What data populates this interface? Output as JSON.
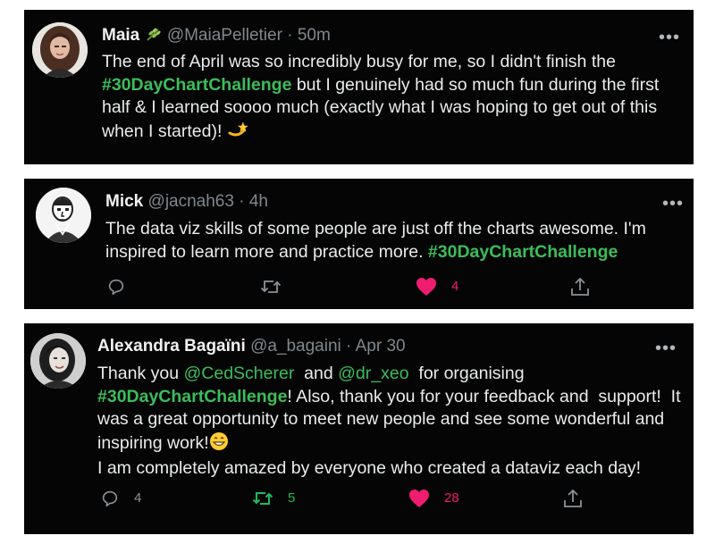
{
  "tweets": [
    {
      "name": "Maia",
      "name_emoji": "🌿",
      "handle": "@MaiaPelletier",
      "sep": "·",
      "time": "50m",
      "lines": [
        [
          "The end of April was so incredibly busy for me, so I didn't finish the"
        ],
        [
          "#30DayChartChallenge",
          " but I genuinely had so much fun during the first"
        ],
        [
          "half & I learned soooo much (exactly what I was hoping to get out of this"
        ],
        [
          "when I started)! "
        ]
      ],
      "trailing_emoji": "💫",
      "more": "•••"
    },
    {
      "name": "Mick",
      "handle": "@jacnah63",
      "sep": "·",
      "time": "4h",
      "lines": [
        [
          "The data viz skills of some people are just off the charts awesome. I'm"
        ],
        [
          "inspired to learn more and practice more. ",
          "#30DayChartChallenge"
        ]
      ],
      "more": "•••",
      "actions": {
        "reply": {
          "icon": "reply-icon",
          "count": ""
        },
        "retweet": {
          "icon": "retweet-icon",
          "count": ""
        },
        "like": {
          "icon": "heart-icon",
          "count": "4",
          "liked": true
        },
        "share": {
          "icon": "share-icon"
        }
      }
    },
    {
      "name": "Alexandra Bagaïni",
      "handle": "@a_bagaini",
      "sep": "·",
      "time": "Apr 30",
      "line1_pre": "Thank you ",
      "mention1": "@CedScherer",
      "line1_mid": "  and ",
      "mention2": "@dr_xeo",
      "line1_post": "  for organising",
      "line2_tag": "#30DayChartChallenge",
      "line2_post": "! Also, thank you for your feedback and  support!  It",
      "line3": "was a great opportunity to meet new people and see some wonderful and",
      "line4": "inspiring work!",
      "line4_emoji": "😁",
      "line5": "I am completely amazed by everyone who created a dataviz each day!",
      "more": "•••",
      "actions": {
        "reply": {
          "icon": "reply-icon",
          "count": "4"
        },
        "retweet": {
          "icon": "retweet-icon",
          "count": "5",
          "retweeted": true
        },
        "like": {
          "icon": "heart-icon",
          "count": "28",
          "liked": true
        },
        "share": {
          "icon": "share-icon"
        }
      }
    }
  ],
  "colors": {
    "card_bg": "#050505",
    "hashtag": "#3bbd5a",
    "like": "#f01c6f",
    "retweet": "#20ba5b",
    "muted": "#8b9298"
  }
}
